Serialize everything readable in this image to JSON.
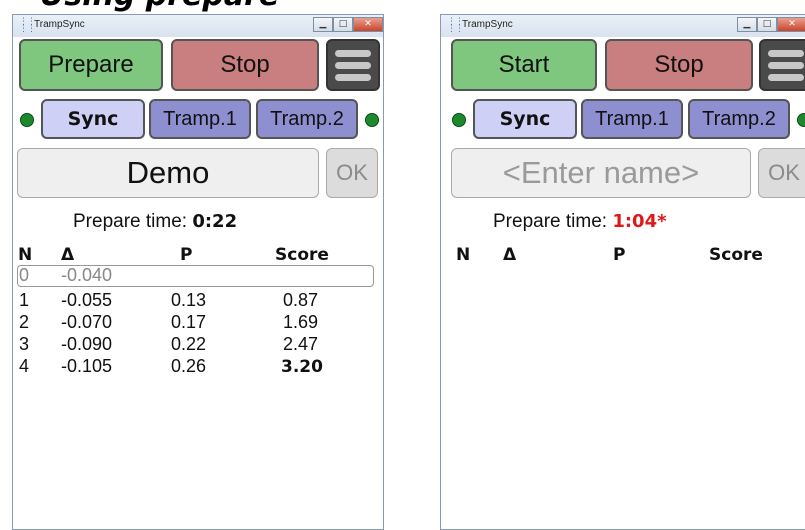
{
  "heading": "Using prepare",
  "left_window": {
    "title": "TrampSync",
    "window_controls": [
      "minimize",
      "maximize",
      "close"
    ],
    "buttons": {
      "primary": "Prepare",
      "stop": "Stop"
    },
    "tabs": [
      "Sync",
      "Tramp.1",
      "Tramp.2"
    ],
    "name_value": "Demo",
    "ok_label": "OK",
    "prepare_label": "Prepare time:",
    "prepare_time": "0:22",
    "columns": [
      "N",
      "Δ",
      "P",
      "Score"
    ],
    "rows": [
      {
        "n": "0",
        "delta": "-0.040",
        "p": "",
        "score": ""
      },
      {
        "n": "1",
        "delta": "-0.055",
        "p": "0.13",
        "score": "0.87"
      },
      {
        "n": "2",
        "delta": "-0.070",
        "p": "0.17",
        "score": "1.69"
      },
      {
        "n": "3",
        "delta": "-0.090",
        "p": "0.22",
        "score": "2.47"
      },
      {
        "n": "4",
        "delta": "-0.105",
        "p": "0.26",
        "score": "3.20"
      }
    ]
  },
  "right_window": {
    "title": "TrampSync",
    "buttons": {
      "primary": "Start",
      "stop": "Stop"
    },
    "tabs": [
      "Sync",
      "Tramp.1",
      "Tramp.2"
    ],
    "name_placeholder": "<Enter name>",
    "ok_label": "OK",
    "prepare_label": "Prepare time:",
    "prepare_time": "1:04*",
    "columns": [
      "N",
      "Δ",
      "P",
      "Score"
    ]
  },
  "colors": {
    "green_button": "#7fc67f",
    "red_button": "#c97f7f",
    "active_tab": "#cfd0f5",
    "inactive_tab": "#8e8fd0",
    "status_dot": "#1c8a2c",
    "warning_time": "#e0181a"
  }
}
